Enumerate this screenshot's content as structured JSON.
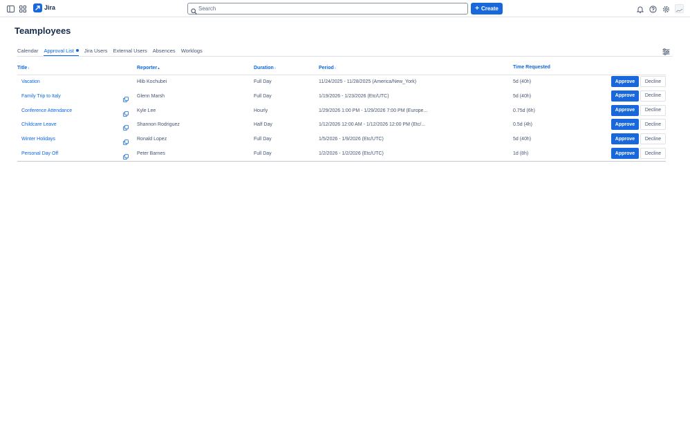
{
  "app": {
    "name": "Jira",
    "create_label": "Create",
    "search_placeholder": "Search",
    "brand_color": "#1868db"
  },
  "topbar_icons": [
    "sidebar-toggle-icon",
    "app-switcher-icon",
    "bell-icon",
    "help-icon",
    "gear-icon"
  ],
  "page": {
    "title": "Teamployees"
  },
  "tabs": [
    {
      "label": "Calendar",
      "active": false
    },
    {
      "label": "Approval List",
      "active": true,
      "has_dot": true
    },
    {
      "label": "Jira Users",
      "active": false
    },
    {
      "label": "External Users",
      "active": false
    },
    {
      "label": "Absences",
      "active": false
    },
    {
      "label": "Worklogs",
      "active": false
    }
  ],
  "table": {
    "columns": {
      "title": "Title",
      "reporter": "Reporter",
      "duration": "Duration",
      "period": "Period",
      "time_requested": "Time Requested"
    },
    "approve_label": "Approve",
    "decline_label": "Decline",
    "rows": [
      {
        "title": "Vacation",
        "has_copy": false,
        "reporter": "Hlib Kochubei",
        "duration": "Full Day",
        "period": "11/24/2025 - 11/28/2025 (America/New_York)",
        "time": "5d (40h)"
      },
      {
        "title": "Family Trip to Italy",
        "has_copy": true,
        "reporter": "Glenn Marsh",
        "duration": "Full Day",
        "period": "1/19/2026 - 1/23/2026 (Etc/UTC)",
        "time": "5d (40h)"
      },
      {
        "title": "Conference Attendance",
        "has_copy": true,
        "reporter": "Kyle Lee",
        "duration": "Hourly",
        "period": "1/29/2026 1:00 PM - 1/29/2026 7:00 PM (Europe...",
        "time": "0.75d (6h)"
      },
      {
        "title": "Childcare Leave",
        "has_copy": true,
        "reporter": "Shannon Rodriguez",
        "duration": "Half Day",
        "period": "1/12/2026 12:00 AM - 1/12/2026 12:00 PM (Etc/...",
        "time": "0.5d (4h)"
      },
      {
        "title": "Winter Holidays",
        "has_copy": true,
        "reporter": "Ronald Lopez",
        "duration": "Full Day",
        "period": "1/5/2026 - 1/9/2026 (Etc/UTC)",
        "time": "5d (40h)"
      },
      {
        "title": "Personal Day Off",
        "has_copy": true,
        "reporter": "Peter Barnes",
        "duration": "Full Day",
        "period": "1/2/2026 - 1/2/2026 (Etc/UTC)",
        "time": "1d (8h)"
      }
    ]
  }
}
